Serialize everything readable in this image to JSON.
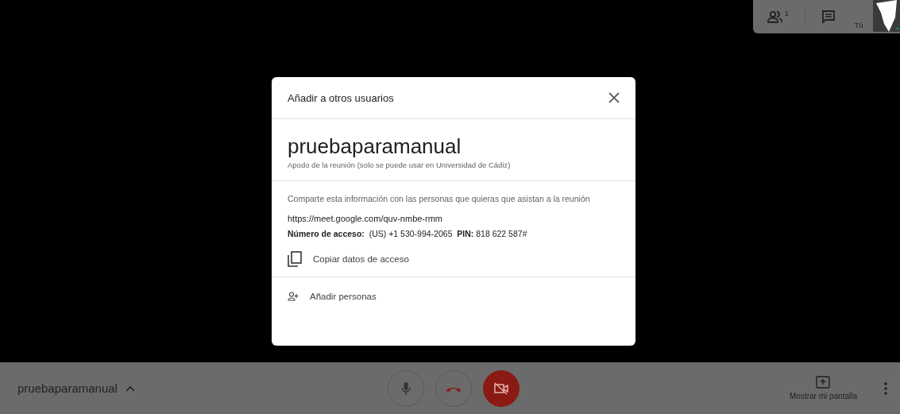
{
  "top_panel": {
    "participants_count": "1",
    "self_label": "Tú"
  },
  "dialog": {
    "title": "Añadir a otros usuarios",
    "meeting_name": "pruebaparamanual",
    "nickname_note": "Apodo de la reunión (solo se puede usar en Universidad de Cádiz)",
    "share_text": "Comparte esta información con las personas que quieras que asistan a la reunión",
    "link": "https://meet.google.com/quv-nmbe-rmm",
    "access_line": "**Número de acceso:**  (US) +1 530-994-2065  **PIN:** 818 622 587#",
    "copy_label": "Copiar datos de acceso",
    "add_people_label": "Añadir personas"
  },
  "bottom_bar": {
    "meeting_name": "pruebaparamanual",
    "mic_on": true,
    "camera_on": false,
    "present_label": "Mostrar mi pantalla"
  }
}
